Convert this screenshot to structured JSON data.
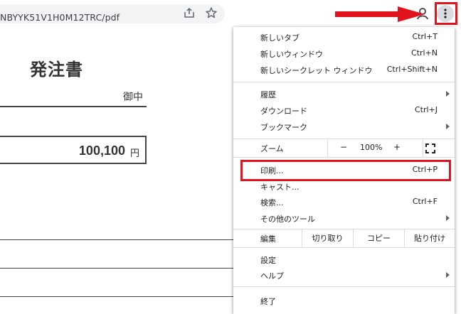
{
  "browser": {
    "url": "NBYYK51V1H0M12TRC/pdf"
  },
  "document": {
    "title": "発注書",
    "recipient_suffix": "御中",
    "amount": "100,100",
    "amount_unit": "円"
  },
  "menu": {
    "new_tab": {
      "label": "新しいタブ",
      "shortcut": "Ctrl+T"
    },
    "new_window": {
      "label": "新しいウィンドウ",
      "shortcut": "Ctrl+N"
    },
    "incognito": {
      "label": "新しいシークレット ウィンドウ",
      "shortcut": "Ctrl+Shift+N"
    },
    "history": {
      "label": "履歴"
    },
    "downloads": {
      "label": "ダウンロード",
      "shortcut": "Ctrl+J"
    },
    "bookmarks": {
      "label": "ブックマーク"
    },
    "zoom": {
      "label": "ズーム",
      "minus": "−",
      "value": "100%",
      "plus": "+"
    },
    "print": {
      "label": "印刷...",
      "shortcut": "Ctrl+P"
    },
    "cast": {
      "label": "キャスト..."
    },
    "find": {
      "label": "検索...",
      "shortcut": "Ctrl+F"
    },
    "more_tools": {
      "label": "その他のツール"
    },
    "edit": {
      "label": "編集",
      "cut": "切り取り",
      "copy": "コピー",
      "paste": "貼り付け"
    },
    "settings": {
      "label": "設定"
    },
    "help": {
      "label": "ヘルプ"
    },
    "exit": {
      "label": "終了"
    }
  },
  "colors": {
    "annotation_red": "#e1141e",
    "menu_separator": "#dadce0"
  }
}
